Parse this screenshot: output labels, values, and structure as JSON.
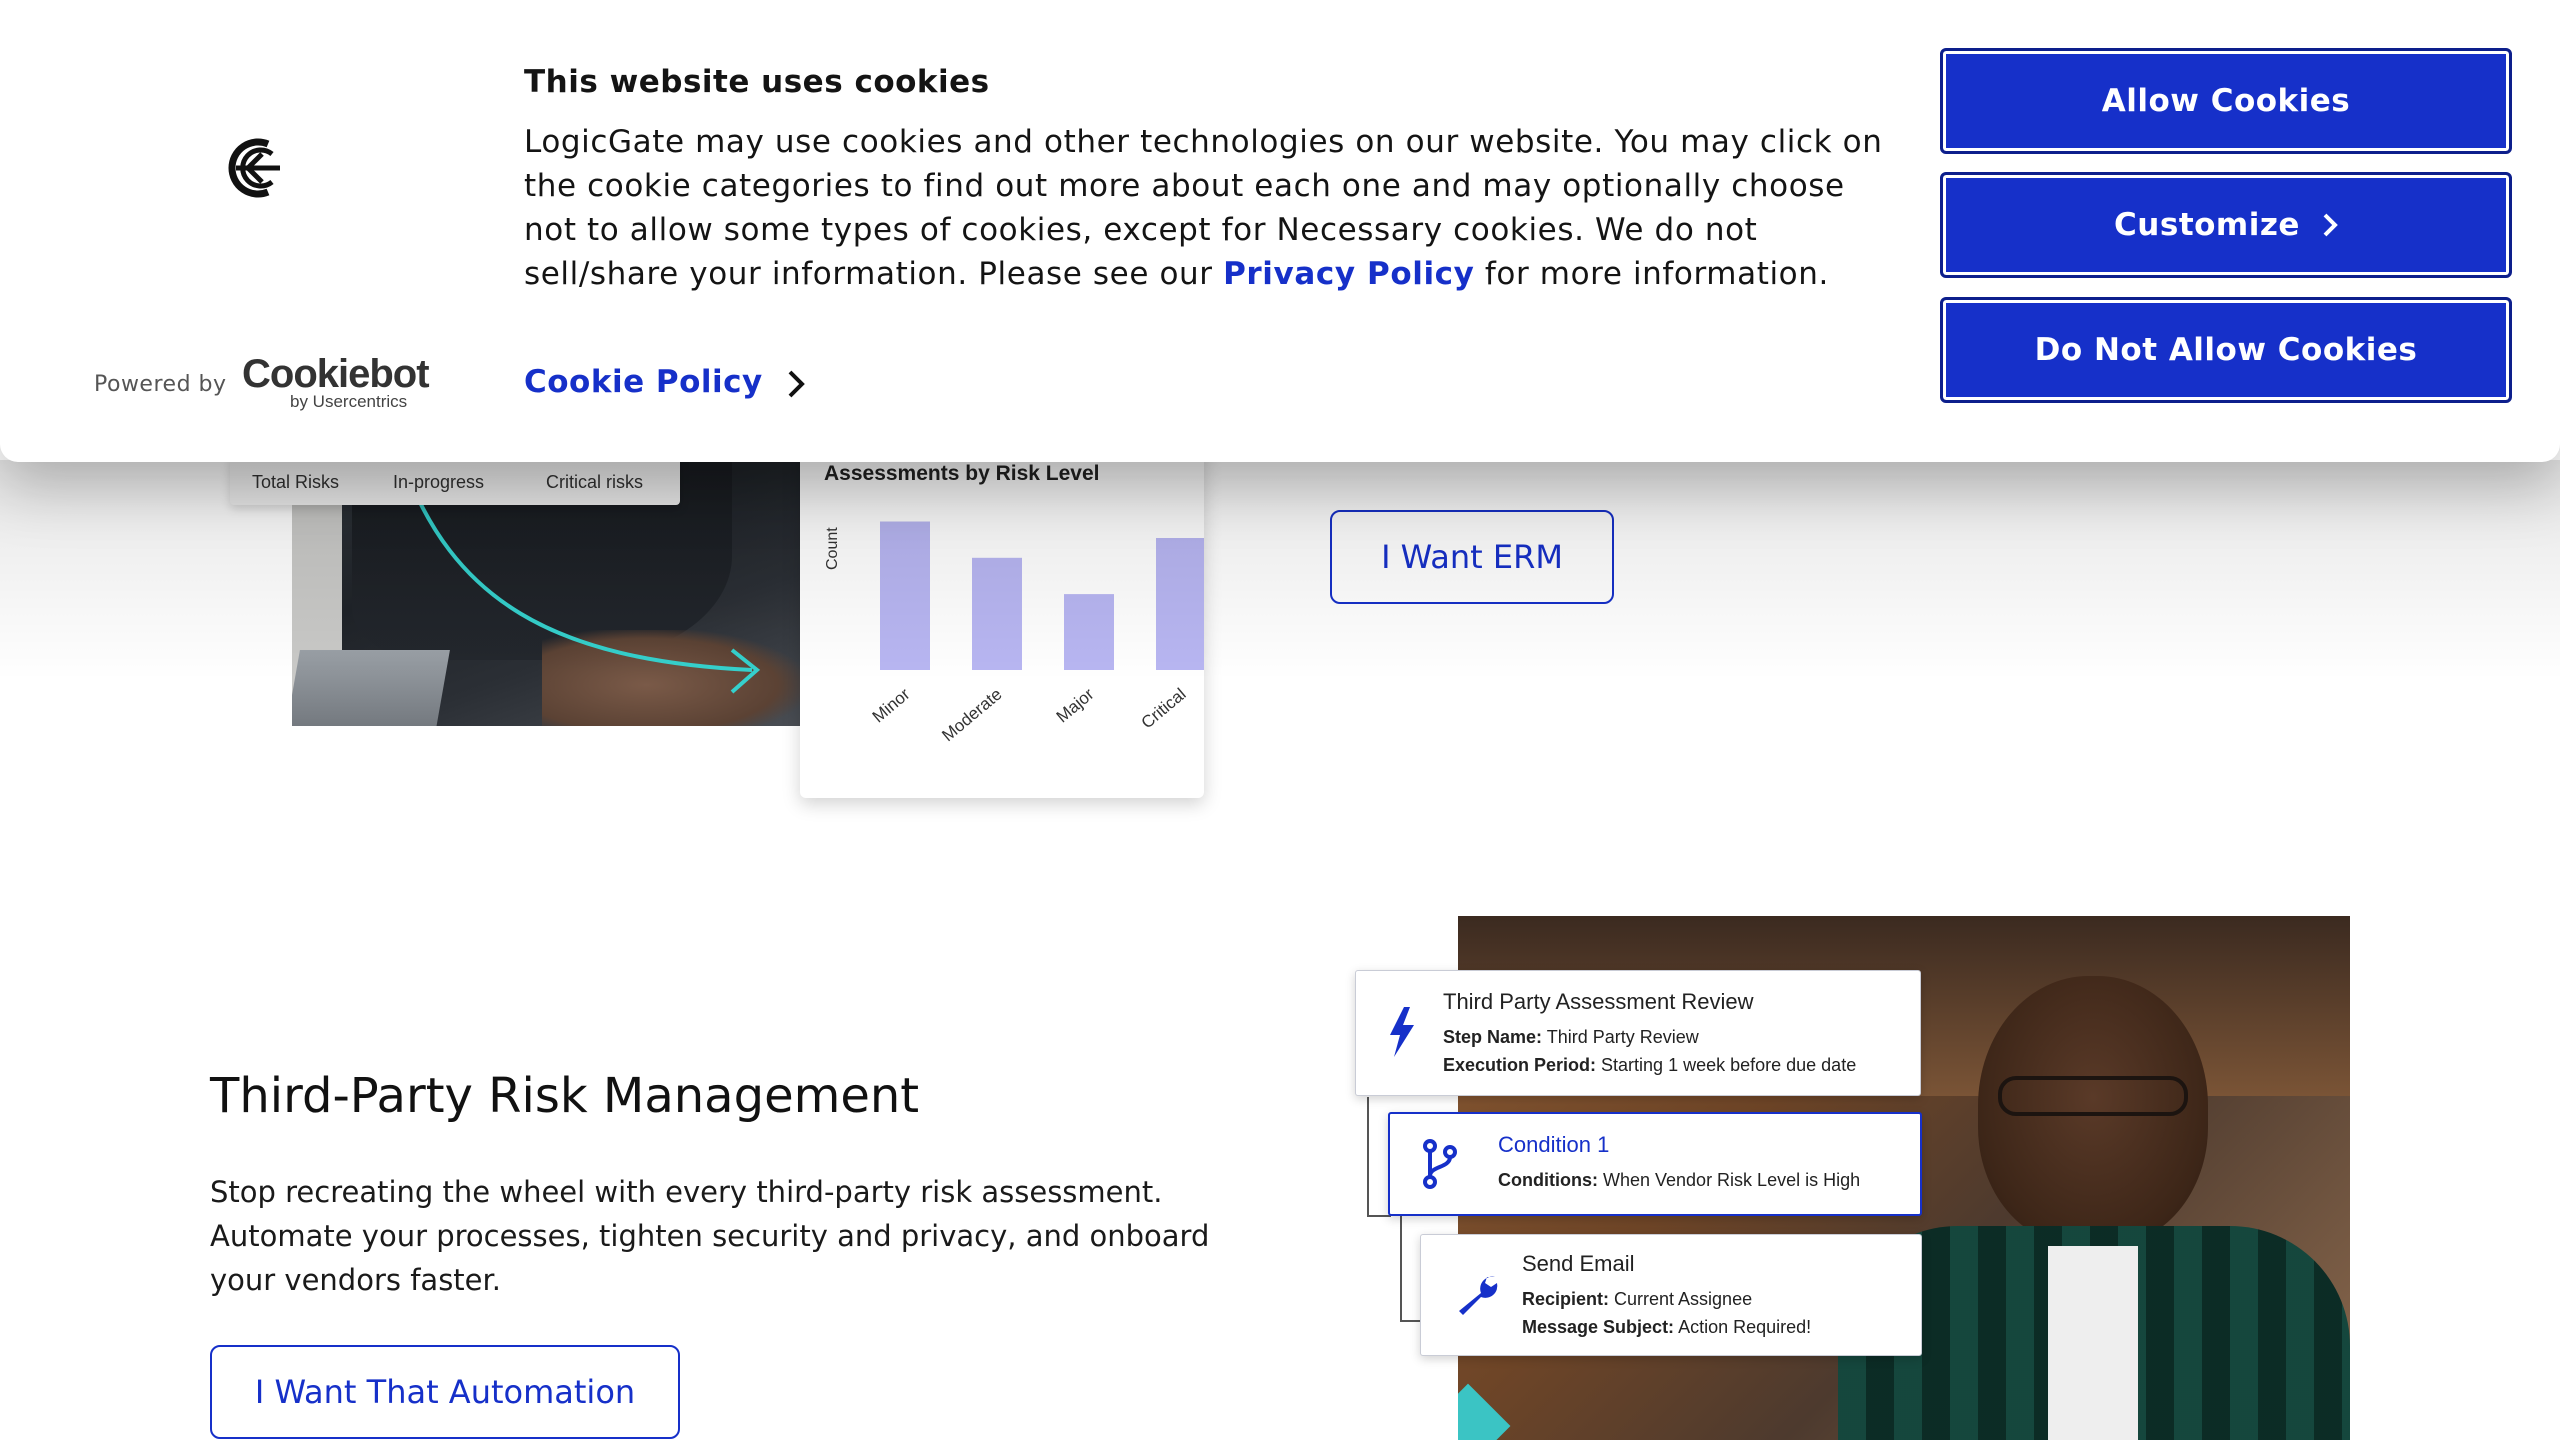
{
  "cookie_banner": {
    "title": "This website uses cookies",
    "body_text": "LogicGate may use cookies and other technologies on our website. You may click on the cookie categories to find out more about each one and may optionally choose not to allow some types of cookies, except for Necessary cookies.  We do not sell/share your information. Please see our ",
    "privacy_link": "Privacy Policy",
    "body_suffix": " for more information.",
    "cookie_policy_link": "Cookie Policy",
    "powered_by": "Powered by",
    "cookiebot_brand": "Cookiebot",
    "cookiebot_sub": "by Usercentrics",
    "buttons": {
      "allow": "Allow Cookies",
      "customize": "Customize",
      "deny": "Do Not Allow Cookies"
    },
    "accent_color": "#1630c9"
  },
  "erm_section": {
    "stats_labels": [
      "Total Risks",
      "In-progress",
      "Critical risks"
    ],
    "cta": "I Want ERM"
  },
  "chart_data": {
    "type": "bar",
    "title": "Assessments by Risk Level",
    "ylabel": "Count",
    "xlabel": "",
    "categories": [
      "Minor",
      "Moderate",
      "Major",
      "Critical"
    ],
    "values": [
      90,
      68,
      46,
      80
    ],
    "ylim": [
      0,
      100
    ],
    "bar_color": "#b8b6f2"
  },
  "tprm_section": {
    "title": "Third-Party Risk Management",
    "description": "Stop recreating the wheel with every third-party risk assessment. Automate your processes, tighten security and privacy, and onboard your vendors faster.",
    "cta": "I Want That Automation",
    "workflow": {
      "step": {
        "title": "Third Party Assessment Review",
        "step_name_label": "Step Name:",
        "step_name_value": " Third Party Review",
        "execution_label": "Execution Period:",
        "execution_value": " Starting 1 week before due date"
      },
      "condition": {
        "title": "Condition 1",
        "conditions_label": "Conditions:",
        "conditions_value": " When Vendor Risk Level is High"
      },
      "email": {
        "title": "Send Email",
        "recipient_label": "Recipient:",
        "recipient_value": " Current Assignee",
        "subject_label": "Message Subject:",
        "subject_value": " Action Required!"
      }
    }
  }
}
